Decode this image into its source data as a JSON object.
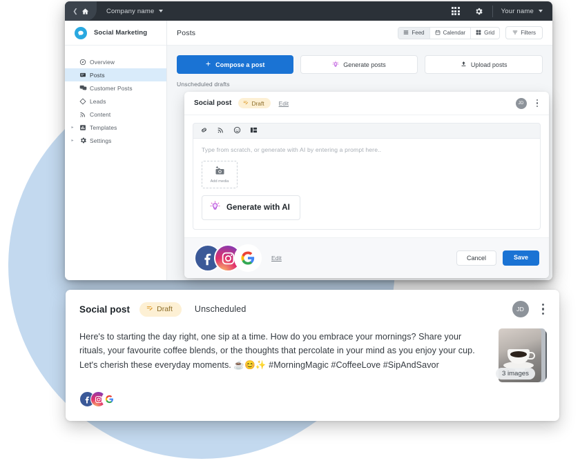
{
  "topbar": {
    "back_icon": "chevron-left-icon",
    "home_icon": "home-icon",
    "company_label": "Company name",
    "apps_icon": "apps-grid-icon",
    "settings_icon": "gear-icon",
    "user_label": "Your name"
  },
  "sidebar": {
    "brand": {
      "name": "Social Marketing",
      "logo_icon": "chat-bubble-logo"
    },
    "items": [
      {
        "label": "Overview",
        "icon": "compass-icon",
        "active": false,
        "expandable": false
      },
      {
        "label": "Posts",
        "icon": "message-icon",
        "active": true,
        "expandable": false
      },
      {
        "label": "Customer Posts",
        "icon": "messages-icon",
        "active": false,
        "expandable": false
      },
      {
        "label": "Leads",
        "icon": "diamond-icon",
        "active": false,
        "expandable": false
      },
      {
        "label": "Content",
        "icon": "rss-icon",
        "active": false,
        "expandable": false
      },
      {
        "label": "Templates",
        "icon": "chart-bar-icon",
        "active": false,
        "expandable": true
      },
      {
        "label": "Settings",
        "icon": "gear-icon",
        "active": false,
        "expandable": true
      }
    ]
  },
  "main": {
    "title": "Posts",
    "views": [
      {
        "label": "Feed",
        "icon": "feed-icon",
        "selected": true
      },
      {
        "label": "Calendar",
        "icon": "calendar-icon",
        "selected": false
      },
      {
        "label": "Grid",
        "icon": "grid-icon",
        "selected": false
      }
    ],
    "filters": {
      "label": "Filters",
      "icon": "filter-icon"
    },
    "actions": [
      {
        "label": "Compose a post",
        "icon": "plus-icon",
        "style": "primary"
      },
      {
        "label": "Generate posts",
        "icon": "ai-bulb-icon",
        "style": "ghost"
      },
      {
        "label": "Upload posts",
        "icon": "upload-icon",
        "style": "ghost"
      }
    ],
    "drafts_label": "Unscheduled drafts"
  },
  "composer": {
    "title": "Social post",
    "status_badge": {
      "label": "Draft",
      "icon": "draft-pencil-icon"
    },
    "edit_link": "Edit",
    "avatar_initials": "JD",
    "menu_icon": "kebab-menu-icon",
    "toolbar_icons": [
      "link-icon",
      "rss-icon",
      "emoji-icon",
      "layout-icon"
    ],
    "editor_placeholder": "Type from scratch, or generate with AI by entering a prompt here..",
    "add_media": {
      "label": "Add media",
      "icon": "camera-add-icon"
    },
    "generate_ai": {
      "label": "Generate with AI",
      "icon": "ai-bulb-icon"
    },
    "networks": [
      "facebook-icon",
      "instagram-icon",
      "google-icon"
    ],
    "footer_edit_link": "Edit",
    "cancel_label": "Cancel",
    "save_label": "Save"
  },
  "post_card": {
    "title": "Social post",
    "status_badge": {
      "label": "Draft",
      "icon": "draft-pencil-icon"
    },
    "schedule": "Unscheduled",
    "avatar_initials": "JD",
    "menu_icon": "kebab-menu-icon",
    "body": "Here's to starting the day right, one sip at a time. How do you embrace your mornings? Share your rituals, your favourite coffee blends, or the thoughts that percolate in your mind as you enjoy your cup. Let's cherish these everyday moments. ☕😊✨ #MorningMagic #CoffeeLove #SipAndSavor",
    "media_badge": "3 images",
    "media_alt": "coffee-cup-photo",
    "networks": [
      "facebook-icon",
      "instagram-icon",
      "google-icon"
    ]
  },
  "colors": {
    "primary": "#1a73d4",
    "active_nav": "#d9ebfa",
    "badge_bg": "#fdf0d4",
    "badge_text": "#8a6a25",
    "topbar": "#2b3138",
    "background_circle": "#c3d9ef",
    "facebook": "#3b5998",
    "instagram": "#d6249f",
    "google_blue": "#4285f4"
  }
}
